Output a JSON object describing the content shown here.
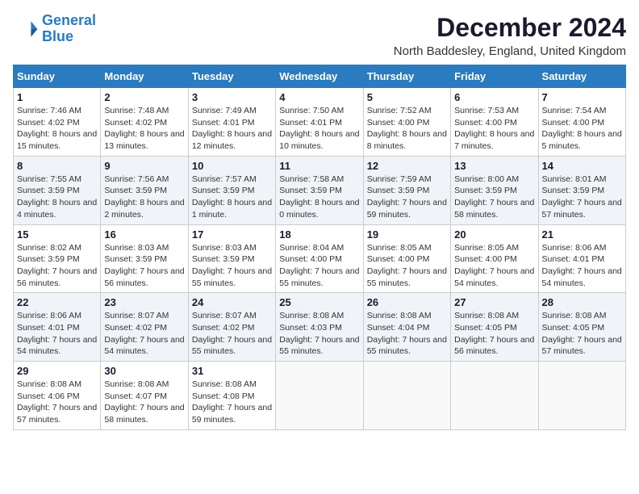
{
  "logo": {
    "line1": "General",
    "line2": "Blue"
  },
  "title": "December 2024",
  "location": "North Baddesley, England, United Kingdom",
  "weekdays": [
    "Sunday",
    "Monday",
    "Tuesday",
    "Wednesday",
    "Thursday",
    "Friday",
    "Saturday"
  ],
  "weeks": [
    [
      {
        "day": "1",
        "sunrise": "Sunrise: 7:46 AM",
        "sunset": "Sunset: 4:02 PM",
        "daylight": "Daylight: 8 hours and 15 minutes."
      },
      {
        "day": "2",
        "sunrise": "Sunrise: 7:48 AM",
        "sunset": "Sunset: 4:02 PM",
        "daylight": "Daylight: 8 hours and 13 minutes."
      },
      {
        "day": "3",
        "sunrise": "Sunrise: 7:49 AM",
        "sunset": "Sunset: 4:01 PM",
        "daylight": "Daylight: 8 hours and 12 minutes."
      },
      {
        "day": "4",
        "sunrise": "Sunrise: 7:50 AM",
        "sunset": "Sunset: 4:01 PM",
        "daylight": "Daylight: 8 hours and 10 minutes."
      },
      {
        "day": "5",
        "sunrise": "Sunrise: 7:52 AM",
        "sunset": "Sunset: 4:00 PM",
        "daylight": "Daylight: 8 hours and 8 minutes."
      },
      {
        "day": "6",
        "sunrise": "Sunrise: 7:53 AM",
        "sunset": "Sunset: 4:00 PM",
        "daylight": "Daylight: 8 hours and 7 minutes."
      },
      {
        "day": "7",
        "sunrise": "Sunrise: 7:54 AM",
        "sunset": "Sunset: 4:00 PM",
        "daylight": "Daylight: 8 hours and 5 minutes."
      }
    ],
    [
      {
        "day": "8",
        "sunrise": "Sunrise: 7:55 AM",
        "sunset": "Sunset: 3:59 PM",
        "daylight": "Daylight: 8 hours and 4 minutes."
      },
      {
        "day": "9",
        "sunrise": "Sunrise: 7:56 AM",
        "sunset": "Sunset: 3:59 PM",
        "daylight": "Daylight: 8 hours and 2 minutes."
      },
      {
        "day": "10",
        "sunrise": "Sunrise: 7:57 AM",
        "sunset": "Sunset: 3:59 PM",
        "daylight": "Daylight: 8 hours and 1 minute."
      },
      {
        "day": "11",
        "sunrise": "Sunrise: 7:58 AM",
        "sunset": "Sunset: 3:59 PM",
        "daylight": "Daylight: 8 hours and 0 minutes."
      },
      {
        "day": "12",
        "sunrise": "Sunrise: 7:59 AM",
        "sunset": "Sunset: 3:59 PM",
        "daylight": "Daylight: 7 hours and 59 minutes."
      },
      {
        "day": "13",
        "sunrise": "Sunrise: 8:00 AM",
        "sunset": "Sunset: 3:59 PM",
        "daylight": "Daylight: 7 hours and 58 minutes."
      },
      {
        "day": "14",
        "sunrise": "Sunrise: 8:01 AM",
        "sunset": "Sunset: 3:59 PM",
        "daylight": "Daylight: 7 hours and 57 minutes."
      }
    ],
    [
      {
        "day": "15",
        "sunrise": "Sunrise: 8:02 AM",
        "sunset": "Sunset: 3:59 PM",
        "daylight": "Daylight: 7 hours and 56 minutes."
      },
      {
        "day": "16",
        "sunrise": "Sunrise: 8:03 AM",
        "sunset": "Sunset: 3:59 PM",
        "daylight": "Daylight: 7 hours and 56 minutes."
      },
      {
        "day": "17",
        "sunrise": "Sunrise: 8:03 AM",
        "sunset": "Sunset: 3:59 PM",
        "daylight": "Daylight: 7 hours and 55 minutes."
      },
      {
        "day": "18",
        "sunrise": "Sunrise: 8:04 AM",
        "sunset": "Sunset: 4:00 PM",
        "daylight": "Daylight: 7 hours and 55 minutes."
      },
      {
        "day": "19",
        "sunrise": "Sunrise: 8:05 AM",
        "sunset": "Sunset: 4:00 PM",
        "daylight": "Daylight: 7 hours and 55 minutes."
      },
      {
        "day": "20",
        "sunrise": "Sunrise: 8:05 AM",
        "sunset": "Sunset: 4:00 PM",
        "daylight": "Daylight: 7 hours and 54 minutes."
      },
      {
        "day": "21",
        "sunrise": "Sunrise: 8:06 AM",
        "sunset": "Sunset: 4:01 PM",
        "daylight": "Daylight: 7 hours and 54 minutes."
      }
    ],
    [
      {
        "day": "22",
        "sunrise": "Sunrise: 8:06 AM",
        "sunset": "Sunset: 4:01 PM",
        "daylight": "Daylight: 7 hours and 54 minutes."
      },
      {
        "day": "23",
        "sunrise": "Sunrise: 8:07 AM",
        "sunset": "Sunset: 4:02 PM",
        "daylight": "Daylight: 7 hours and 54 minutes."
      },
      {
        "day": "24",
        "sunrise": "Sunrise: 8:07 AM",
        "sunset": "Sunset: 4:02 PM",
        "daylight": "Daylight: 7 hours and 55 minutes."
      },
      {
        "day": "25",
        "sunrise": "Sunrise: 8:08 AM",
        "sunset": "Sunset: 4:03 PM",
        "daylight": "Daylight: 7 hours and 55 minutes."
      },
      {
        "day": "26",
        "sunrise": "Sunrise: 8:08 AM",
        "sunset": "Sunset: 4:04 PM",
        "daylight": "Daylight: 7 hours and 55 minutes."
      },
      {
        "day": "27",
        "sunrise": "Sunrise: 8:08 AM",
        "sunset": "Sunset: 4:05 PM",
        "daylight": "Daylight: 7 hours and 56 minutes."
      },
      {
        "day": "28",
        "sunrise": "Sunrise: 8:08 AM",
        "sunset": "Sunset: 4:05 PM",
        "daylight": "Daylight: 7 hours and 57 minutes."
      }
    ],
    [
      {
        "day": "29",
        "sunrise": "Sunrise: 8:08 AM",
        "sunset": "Sunset: 4:06 PM",
        "daylight": "Daylight: 7 hours and 57 minutes."
      },
      {
        "day": "30",
        "sunrise": "Sunrise: 8:08 AM",
        "sunset": "Sunset: 4:07 PM",
        "daylight": "Daylight: 7 hours and 58 minutes."
      },
      {
        "day": "31",
        "sunrise": "Sunrise: 8:08 AM",
        "sunset": "Sunset: 4:08 PM",
        "daylight": "Daylight: 7 hours and 59 minutes."
      },
      null,
      null,
      null,
      null
    ]
  ]
}
